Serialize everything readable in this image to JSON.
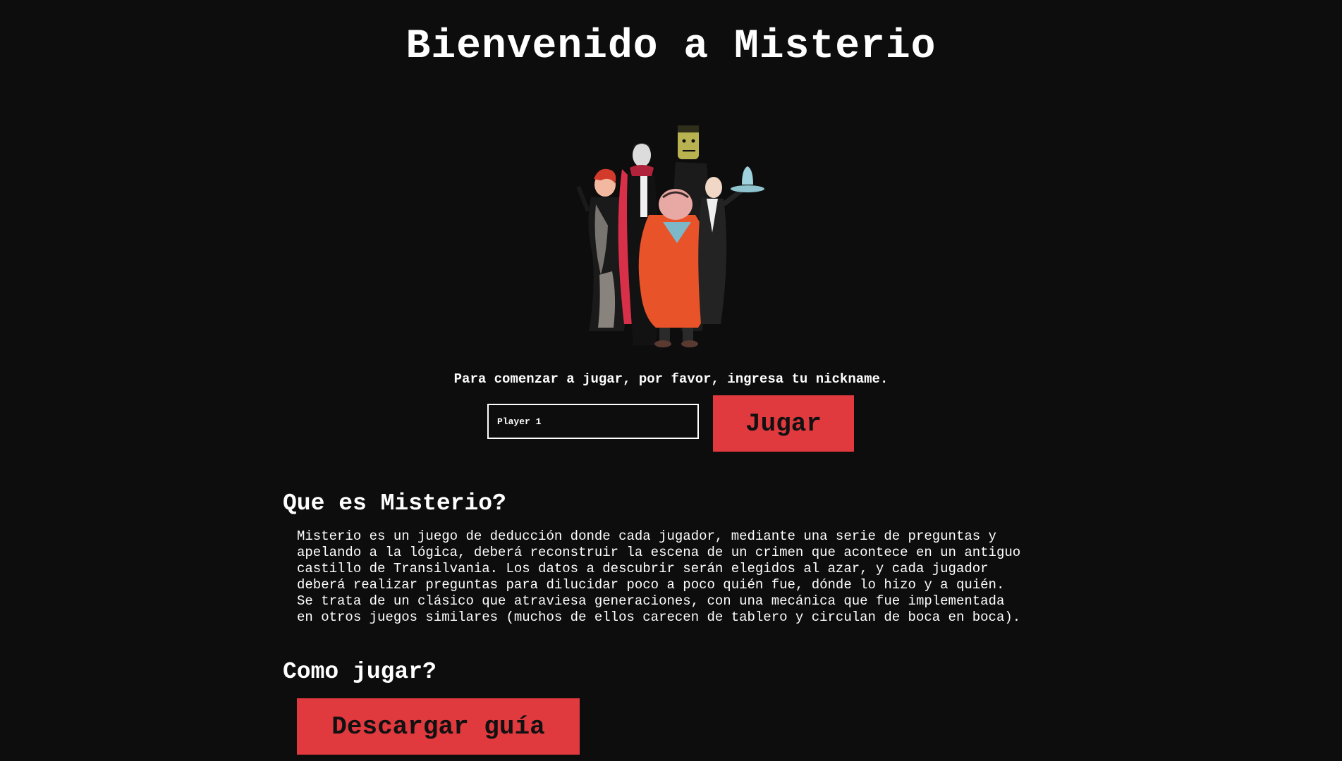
{
  "header": {
    "title": "Bienvenido a Misterio"
  },
  "hero": {
    "image_icon": "mystery-characters-illustration"
  },
  "start": {
    "prompt": "Para comenzar a jugar, por favor, ingresa tu nickname.",
    "nickname_value": "Player 1",
    "play_label": "Jugar"
  },
  "about": {
    "heading": "Que es Misterio?",
    "text": "Misterio es un juego de deducción donde cada jugador, mediante una serie de preguntas y\napelando a la lógica, deberá reconstruir la escena de un crimen que acontece en un antiguo\ncastillo de Transilvania. Los datos a descubrir serán elegidos al azar, y cada jugador\ndeberá realizar preguntas para dilucidar poco a poco quién fue, dónde lo hizo y a quién.\nSe trata de un clásico que atraviesa generaciones, con una mecánica que fue implementada\nen otros juegos similares (muchos de ellos carecen de tablero y circulan de boca en boca)."
  },
  "howto": {
    "heading": "Como jugar?",
    "guide_label": "Descargar guía"
  },
  "colors": {
    "background": "#0d0d0d",
    "accent": "#e0393e",
    "text": "#ffffff"
  }
}
